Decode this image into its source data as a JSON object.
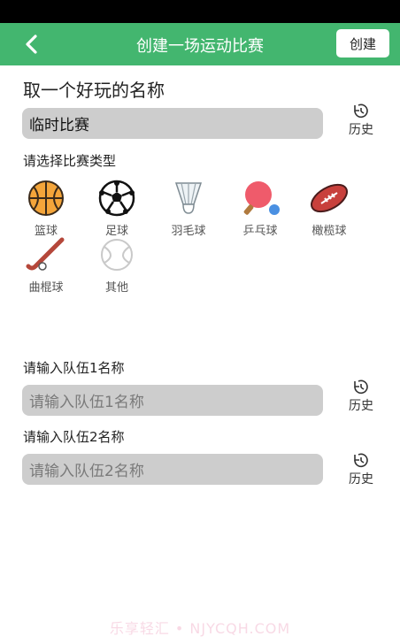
{
  "header": {
    "title": "创建一场运动比赛",
    "create_label": "创建",
    "back_icon": "chevron-left-icon"
  },
  "match_name": {
    "heading": "取一个好玩的名称",
    "value": "临时比赛",
    "history_label": "历史"
  },
  "sport_type": {
    "label": "请选择比赛类型",
    "items": [
      {
        "label": "篮球",
        "icon": "basketball-icon"
      },
      {
        "label": "足球",
        "icon": "soccer-ball-icon"
      },
      {
        "label": "羽毛球",
        "icon": "shuttlecock-icon"
      },
      {
        "label": "乒乓球",
        "icon": "ping-pong-icon"
      },
      {
        "label": "橄榄球",
        "icon": "rugby-ball-icon"
      },
      {
        "label": "曲棍球",
        "icon": "hockey-stick-icon"
      },
      {
        "label": "其他",
        "icon": "other-ball-icon"
      }
    ]
  },
  "team1": {
    "label": "请输入队伍1名称",
    "placeholder": "请输入队伍1名称",
    "history_label": "历史"
  },
  "team2": {
    "label": "请输入队伍2名称",
    "placeholder": "请输入队伍2名称",
    "history_label": "历史"
  },
  "watermark": "乐享轻汇 • NJYCQH.COM",
  "colors": {
    "accent": "#43b66f",
    "field_bg": "#cdcdcd"
  }
}
